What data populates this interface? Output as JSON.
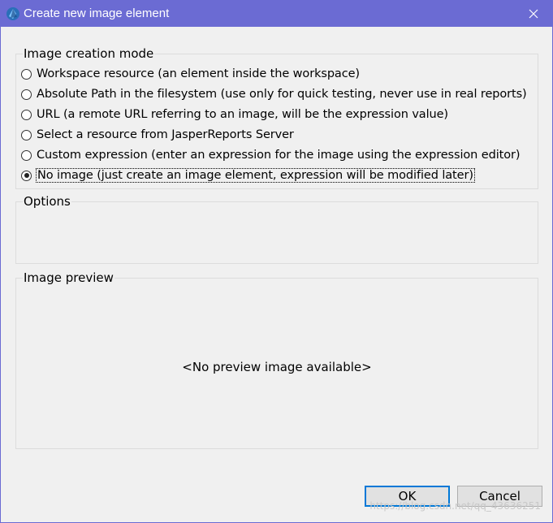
{
  "window": {
    "title": "Create new image element",
    "icons": {
      "app": "jaspersoft-app-icon",
      "close": "close-icon"
    }
  },
  "creation_mode": {
    "label": "Image creation mode",
    "options": [
      {
        "label": "Workspace resource (an element inside the workspace)",
        "selected": false
      },
      {
        "label": "Absolute Path in the filesystem (use only for quick testing, never use in real reports)",
        "selected": false
      },
      {
        "label": "URL (a remote URL referring to an image, will be the expression value)",
        "selected": false
      },
      {
        "label": "Select a resource from JasperReports Server",
        "selected": false
      },
      {
        "label": "Custom expression (enter an expression for the image using the expression editor)",
        "selected": false
      },
      {
        "label": "No image (just create an image element, expression will be modified later)",
        "selected": true
      }
    ]
  },
  "options": {
    "label": "Options"
  },
  "preview": {
    "label": "Image preview",
    "message": "<No preview image available>"
  },
  "buttons": {
    "ok": "OK",
    "cancel": "Cancel"
  },
  "watermark": "https://blog.csdn.net/qq_43636251",
  "colors": {
    "titlebar": "#6b6bd3",
    "default_button_border": "#0078d7"
  }
}
